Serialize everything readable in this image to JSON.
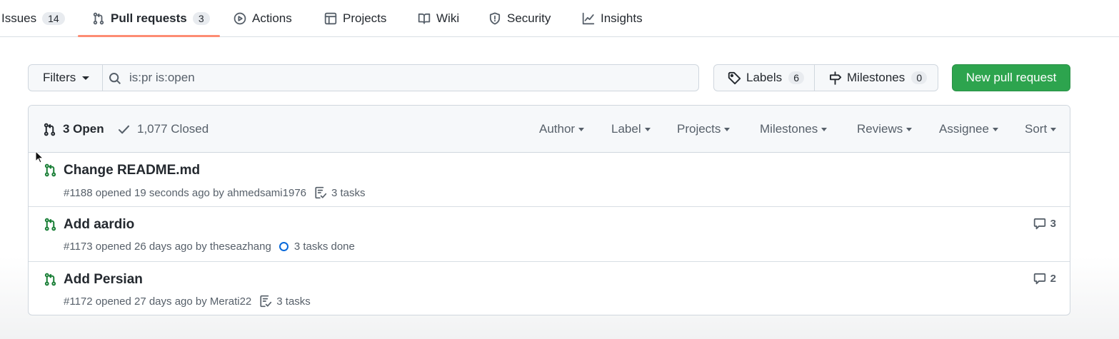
{
  "repo_nav": {
    "tabs": [
      {
        "label": "Issues",
        "count": "14",
        "icon": "issue-opened-icon"
      },
      {
        "label": "Pull requests",
        "count": "3",
        "icon": "git-pull-request-icon",
        "selected": true
      },
      {
        "label": "Actions",
        "icon": "play-icon"
      },
      {
        "label": "Projects",
        "icon": "table-icon"
      },
      {
        "label": "Wiki",
        "icon": "book-icon"
      },
      {
        "label": "Security",
        "icon": "shield-icon"
      },
      {
        "label": "Insights",
        "icon": "graph-icon"
      }
    ]
  },
  "subnav": {
    "filters_label": "Filters",
    "search_value": "is:pr is:open",
    "labels_label": "Labels",
    "labels_count": "6",
    "milestones_label": "Milestones",
    "milestones_count": "0",
    "new_pr_label": "New pull request"
  },
  "list_header": {
    "open_label": "3 Open",
    "closed_label": "1,077 Closed",
    "filters": [
      "Author",
      "Label",
      "Projects",
      "Milestones",
      "Reviews",
      "Assignee",
      "Sort"
    ]
  },
  "pull_requests": [
    {
      "title": "Change README.md",
      "number_opened": "#1188 opened 19 seconds ago by",
      "author": "ahmedsami1976",
      "tasks": "3 tasks",
      "tasks_icon": "checklist-icon",
      "comments": ""
    },
    {
      "title": "Add aardio",
      "number_opened": "#1173 opened 26 days ago by",
      "author": "theseazhang",
      "tasks": "3 tasks done",
      "tasks_icon": "progress-ring-icon",
      "comments": "3"
    },
    {
      "title": "Add Persian",
      "number_opened": "#1172 opened 27 days ago by",
      "author": "Merati22",
      "tasks": "3 tasks",
      "tasks_icon": "checklist-icon",
      "comments": "2"
    }
  ],
  "colors": {
    "accent_green": "#2da44e",
    "open_icon": "#1a7f37",
    "tab_underline": "#fd8c73",
    "progress_blue": "#0969da"
  }
}
